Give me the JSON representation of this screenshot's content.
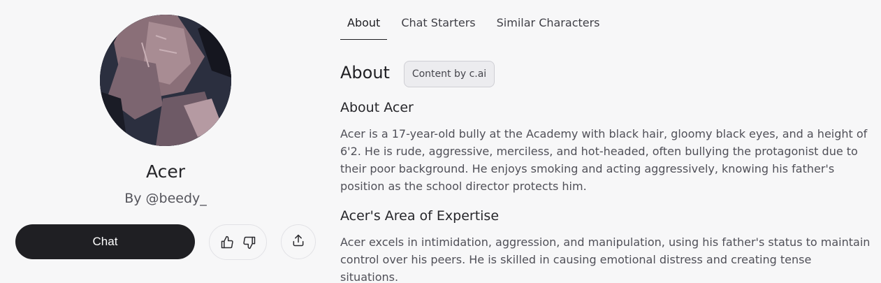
{
  "profile": {
    "name": "Acer",
    "author": "By @beedy_",
    "chat_label": "Chat"
  },
  "tabs": [
    {
      "label": "About",
      "active": true
    },
    {
      "label": "Chat Starters",
      "active": false
    },
    {
      "label": "Similar Characters",
      "active": false
    }
  ],
  "about": {
    "title": "About",
    "badge": "Content by c.ai",
    "sections": [
      {
        "heading": "About Acer",
        "text": "Acer is a 17-year-old bully at the Academy with black hair, gloomy black eyes, and a height of 6'2. He is rude, aggressive, merciless, and hot-headed, often bullying the protagonist due to their poor background. He enjoys smoking and acting aggressively, knowing his father's position as the school director protects him."
      },
      {
        "heading": "Acer's Area of Expertise",
        "text": "Acer excels in intimidation, aggression, and manipulation, using his father's status to maintain control over his peers. He is skilled in causing emotional distress and creating tense situations."
      }
    ]
  },
  "icons": {
    "like": "thumbs-up-icon",
    "dislike": "thumbs-down-icon",
    "share": "share-icon"
  },
  "colors": {
    "background": "#f7f7f8",
    "chat_button": "#1f1f23",
    "text_primary": "#202024",
    "text_secondary": "#505058"
  }
}
